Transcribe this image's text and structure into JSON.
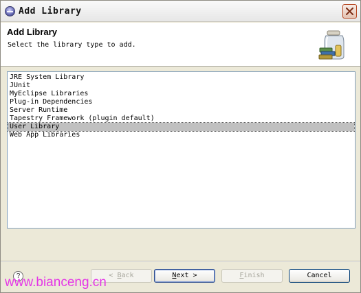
{
  "window": {
    "title": "Add Library"
  },
  "header": {
    "title": "Add Library",
    "description": "Select the library type to add."
  },
  "library_types": [
    {
      "label": "JRE System Library",
      "selected": false
    },
    {
      "label": "JUnit",
      "selected": false
    },
    {
      "label": "MyEclipse Libraries",
      "selected": false
    },
    {
      "label": "Plug-in Dependencies",
      "selected": false
    },
    {
      "label": "Server Runtime",
      "selected": false
    },
    {
      "label": "Tapestry Framework (plugin default)",
      "selected": false
    },
    {
      "label": "User Library",
      "selected": true
    },
    {
      "label": "Web App Libraries",
      "selected": false
    }
  ],
  "buttons": {
    "help": "?",
    "back_arrow": "< ",
    "back_mnemonic": "B",
    "back_rest": "ack",
    "next_mnemonic": "N",
    "next_rest": "ext >",
    "finish_mnemonic": "F",
    "finish_rest": "inish",
    "cancel": "Cancel"
  },
  "watermark": "www.bianceng.cn",
  "icons": {
    "app": "eclipse-icon",
    "close": "close-icon",
    "banner": "library-jar-icon",
    "help": "help-icon"
  },
  "colors": {
    "selection": "#c0c0c0",
    "dialog_bg": "#ece9d8",
    "watermark": "#e436e6",
    "close_border": "#b6441e"
  }
}
